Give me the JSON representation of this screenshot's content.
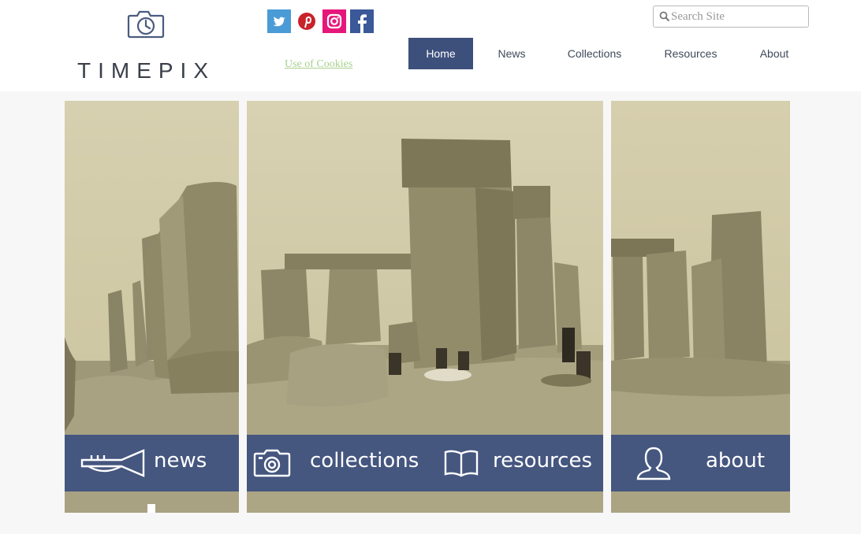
{
  "brand": {
    "name": "TIMEPIX",
    "logo_icon": "camera-clock-icon"
  },
  "social": [
    {
      "name": "twitter",
      "icon": "twitter-icon",
      "color": "#4a9bd6"
    },
    {
      "name": "pinterest",
      "icon": "pinterest-icon",
      "color": "#c9222a"
    },
    {
      "name": "instagram",
      "icon": "instagram-icon",
      "color": "#e6177a"
    },
    {
      "name": "facebook",
      "icon": "facebook-icon",
      "color": "#3b5998"
    }
  ],
  "cookies_link": "Use of Cookies",
  "search": {
    "placeholder": "Search Site",
    "icon": "search-icon"
  },
  "nav": {
    "active": "Home",
    "items": [
      {
        "label": "Home"
      },
      {
        "label": "News"
      },
      {
        "label": "Collections"
      },
      {
        "label": "Resources"
      },
      {
        "label": "About"
      }
    ]
  },
  "tiles": [
    {
      "label": "news",
      "icon": "trumpet-icon"
    },
    {
      "label": "collections",
      "icon": "camera-icon"
    },
    {
      "label": "resources",
      "icon": "book-icon"
    },
    {
      "label": "about",
      "icon": "person-icon"
    }
  ],
  "colors": {
    "nav_active": "#3d4f7b",
    "tile_bar": "#45567f",
    "cookies_link": "#a8d08d",
    "sepia": "#cfc7a4"
  }
}
